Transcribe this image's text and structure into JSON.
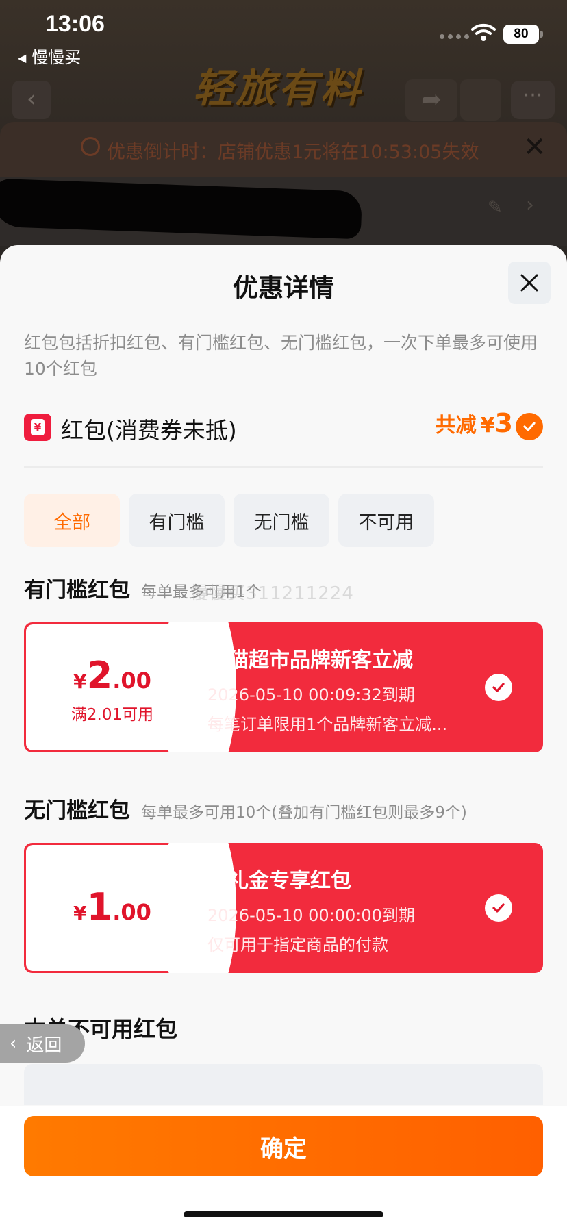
{
  "status_bar": {
    "time": "13:06",
    "back_app": "慢慢买",
    "battery": "80"
  },
  "background_page": {
    "logo_text": "轻旅有料",
    "countdown": "优惠倒计时：店铺优惠1元将在10:53:05失效"
  },
  "sheet": {
    "title": "优惠详情",
    "description": "红包包括折扣红包、有门槛红包、无门槛红包，一次下单最多可使用10个红包",
    "red_packet_row": {
      "icon_char": "¥",
      "label": "红包(消费券未抵)",
      "total_label": "共减",
      "total_currency": "¥",
      "total_value": "3"
    },
    "tabs": [
      {
        "label": "全部",
        "active": true
      },
      {
        "label": "有门槛",
        "active": false
      },
      {
        "label": "无门槛",
        "active": false
      },
      {
        "label": "不可用",
        "active": false
      }
    ],
    "threshold_section": {
      "title": "有门槛红包",
      "subtitle": "每单最多可用1个",
      "watermark": "慢慢买311211224"
    },
    "coupon_1": {
      "currency": "¥",
      "amount_int": "2",
      "amount_dec": ".00",
      "condition": "满2.01可用",
      "title": "天猫超市品牌新客立减",
      "expiry": "2026-05-10 00:09:32到期",
      "note": "每笔订单限用1个品牌新客立减..."
    },
    "no_threshold_section": {
      "title": "无门槛红包",
      "subtitle": "每单最多可用10个(叠加有门槛红包则最多9个)"
    },
    "coupon_2": {
      "currency": "¥",
      "amount_int": "1",
      "amount_dec": ".00",
      "title": "淘礼金专享红包",
      "expiry": "2026-05-10 00:00:00到期",
      "note": "仅可用于指定商品的付款"
    },
    "unusable_title": "本单不可用红包",
    "back_pill": "返回",
    "confirm_label": "确定"
  },
  "colors": {
    "accent_orange": "#ff6a00",
    "coupon_red": "#f22b3d"
  }
}
